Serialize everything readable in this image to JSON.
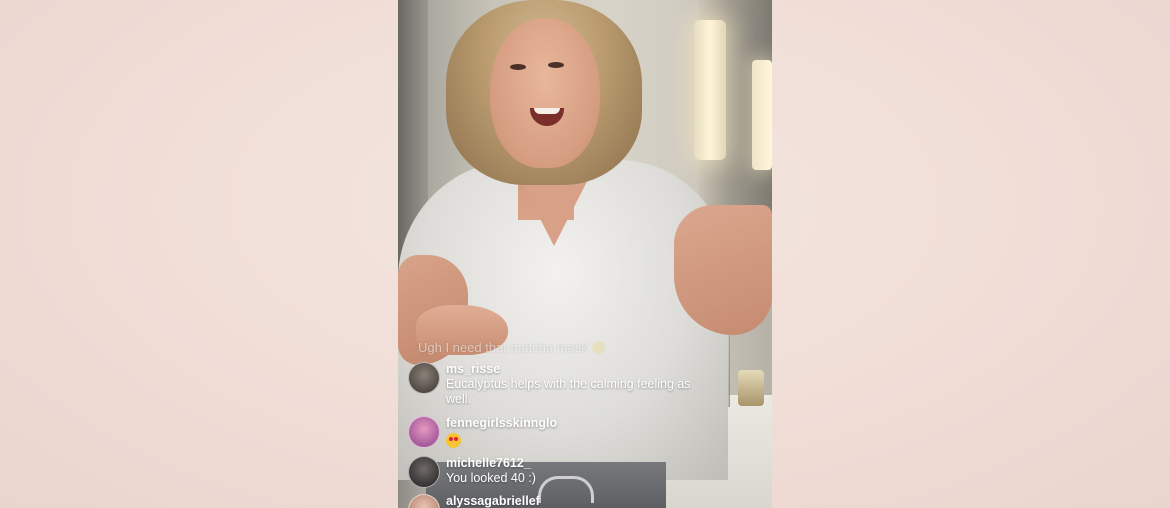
{
  "comments": {
    "faded": {
      "text": "Ugh I need that matcha mask"
    },
    "items": [
      {
        "username": "ms_risse",
        "text": "Eucalyptus helps with the calming feeling as well.",
        "avatar_color": "#3a3530"
      },
      {
        "username": "fennegirlsskinnglo",
        "text": "heart-eyes-emoji",
        "avatar_color": "#b45a8c"
      },
      {
        "username": "michelle7612_",
        "text": "You looked 40 :)",
        "avatar_color": "#2b2a2c"
      },
      {
        "username": "alyssagabriellef",
        "text": "",
        "avatar_color": "#c89a84"
      }
    ]
  },
  "colors": {
    "page_background": "#efdcd5",
    "comment_text": "#ffffff"
  }
}
